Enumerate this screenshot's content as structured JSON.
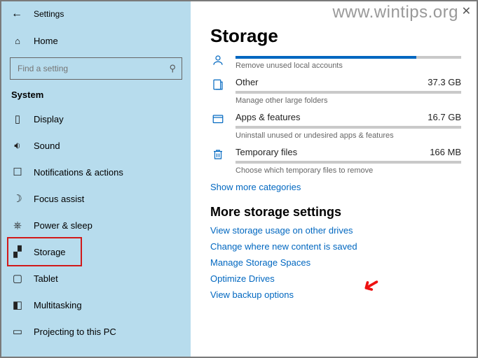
{
  "window": {
    "title": "Settings"
  },
  "watermark": "www.wintips.org",
  "sidebar": {
    "home": "Home",
    "search_placeholder": "Find a setting",
    "section": "System",
    "items": [
      {
        "label": "Display"
      },
      {
        "label": "Sound"
      },
      {
        "label": "Notifications & actions"
      },
      {
        "label": "Focus assist"
      },
      {
        "label": "Power & sleep"
      },
      {
        "label": "Storage"
      },
      {
        "label": "Tablet"
      },
      {
        "label": "Multitasking"
      },
      {
        "label": "Projecting to this PC"
      }
    ]
  },
  "page": {
    "heading": "Storage",
    "categories": [
      {
        "name": "",
        "size": "",
        "sub": "Remove unused local accounts",
        "pct": 80
      },
      {
        "name": "Other",
        "size": "37.3 GB",
        "sub": "Manage other large folders",
        "pct": 0
      },
      {
        "name": "Apps & features",
        "size": "16.7 GB",
        "sub": "Uninstall unused or undesired apps & features",
        "pct": 0
      },
      {
        "name": "Temporary files",
        "size": "166 MB",
        "sub": "Choose which temporary files to remove",
        "pct": 0
      }
    ],
    "show_more": "Show more categories",
    "more_heading": "More storage settings",
    "links": [
      "View storage usage on other drives",
      "Change where new content is saved",
      "Manage Storage Spaces",
      "Optimize Drives",
      "View backup options"
    ]
  }
}
